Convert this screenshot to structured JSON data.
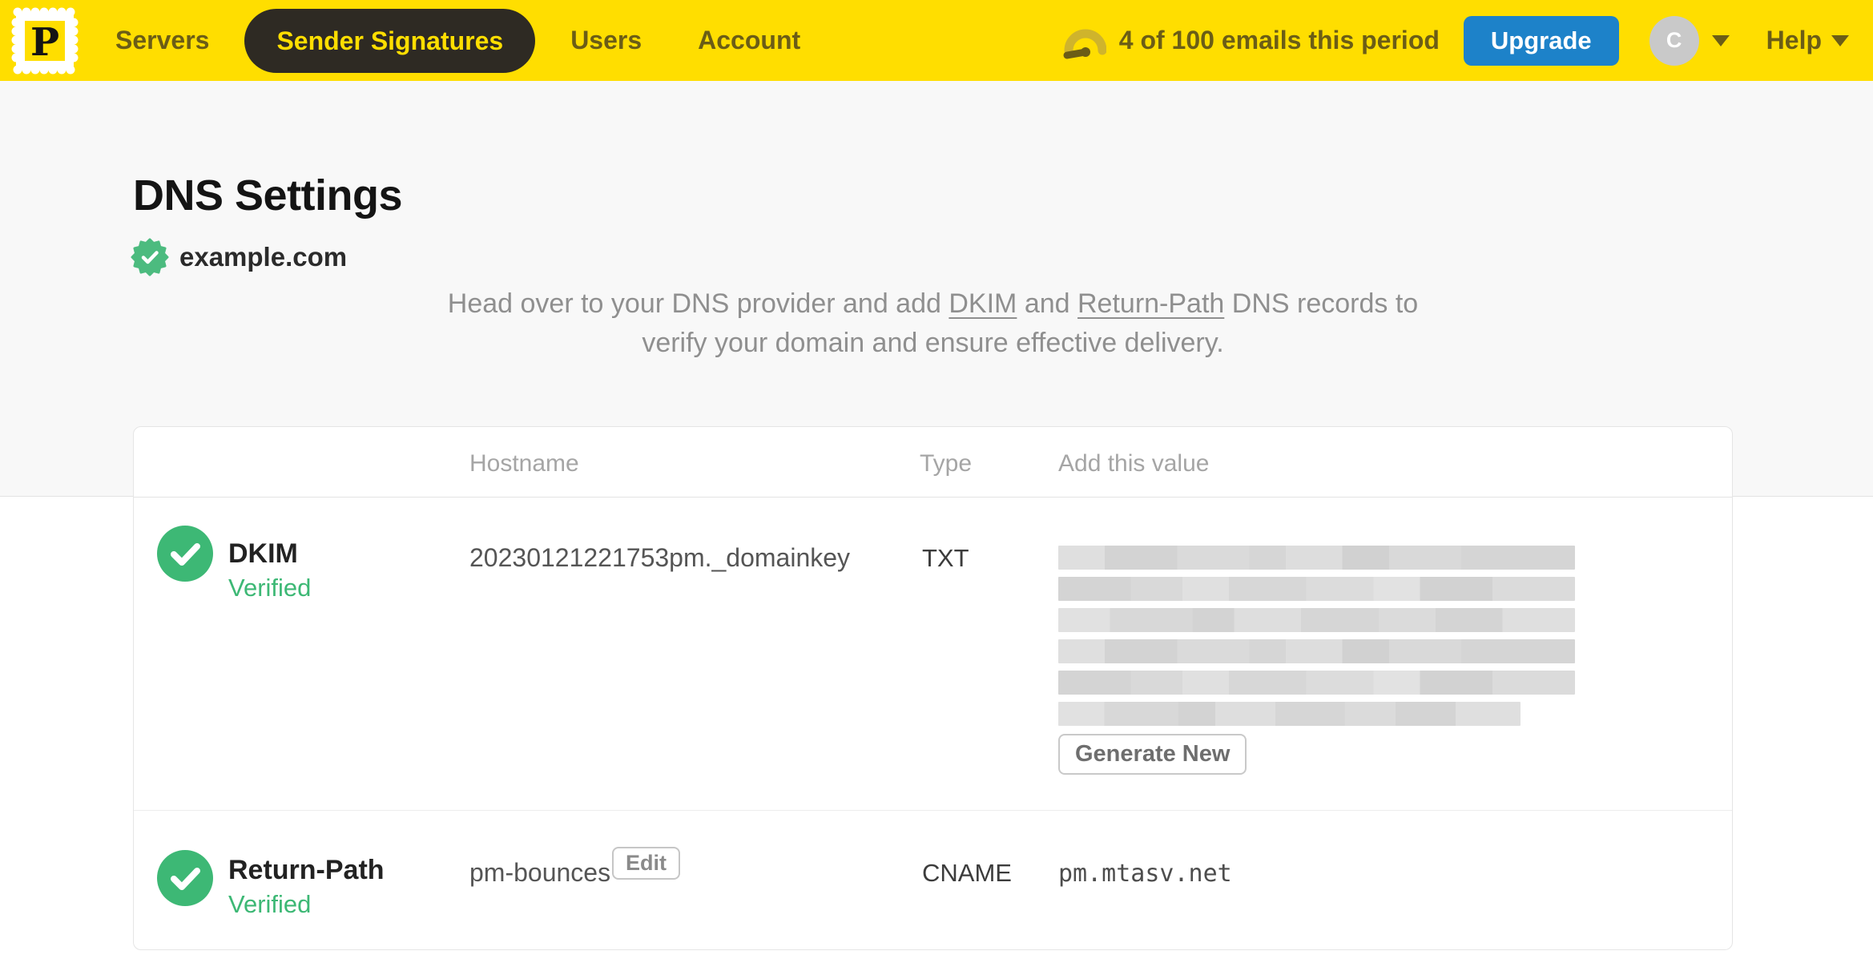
{
  "navbar": {
    "logo_letter": "P",
    "items": [
      {
        "label": "Servers",
        "active": false
      },
      {
        "label": "Sender Signatures",
        "active": true
      },
      {
        "label": "Users",
        "active": false
      },
      {
        "label": "Account",
        "active": false
      }
    ],
    "usage_text": "4 of 100 emails this period",
    "upgrade_label": "Upgrade",
    "avatar_initial": "C",
    "help_label": "Help"
  },
  "page": {
    "title": "DNS Settings",
    "domain": "example.com",
    "instructions": {
      "line1_pre": "Head over to your DNS provider and add ",
      "link_dkim": "DKIM",
      "line1_mid": " and ",
      "link_return_path": "Return-Path",
      "line1_post": " DNS records to",
      "line2": "verify your domain and ensure effective delivery."
    }
  },
  "table": {
    "headers": {
      "hostname": "Hostname",
      "type": "Type",
      "value": "Add this value"
    },
    "rows": [
      {
        "name": "DKIM",
        "status": "Verified",
        "hostname": "20230121221753pm._domainkey",
        "type": "TXT",
        "value_redacted": true,
        "action_label": "Generate New"
      },
      {
        "name": "Return-Path",
        "status": "Verified",
        "hostname": "pm-bounces",
        "edit_label": "Edit",
        "type": "CNAME",
        "value": "pm.mtasv.net"
      }
    ]
  },
  "colors": {
    "brand_yellow": "#FFDE00",
    "nav_text": "#6b5d16",
    "active_pill_bg": "#2e2a23",
    "upgrade_blue": "#1d82c9",
    "verified_green": "#3db875",
    "page_gray": "#f8f8f8"
  }
}
